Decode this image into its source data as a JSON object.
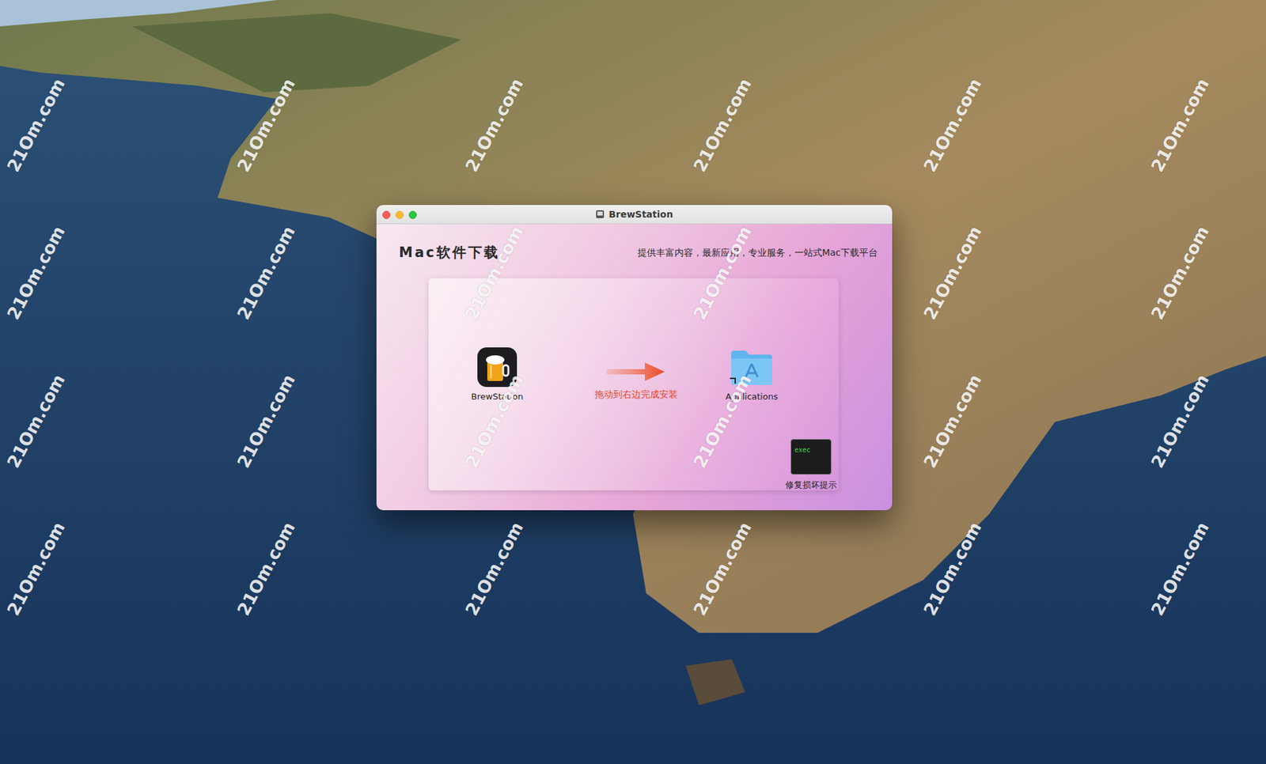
{
  "window": {
    "title": "BrewStation"
  },
  "header": {
    "brand": "Mac软件下载",
    "slogan": "提供丰富内容，最新应用，专业服务，一站式Mac下载平台"
  },
  "installer": {
    "app": {
      "label": "BrewStation"
    },
    "instruction": "拖动到右边完成安装",
    "target": {
      "label": "Applications"
    },
    "repair": {
      "icon_text": "exec",
      "label": "修复损坏提示"
    }
  },
  "watermark": {
    "text": "21Om.com"
  }
}
